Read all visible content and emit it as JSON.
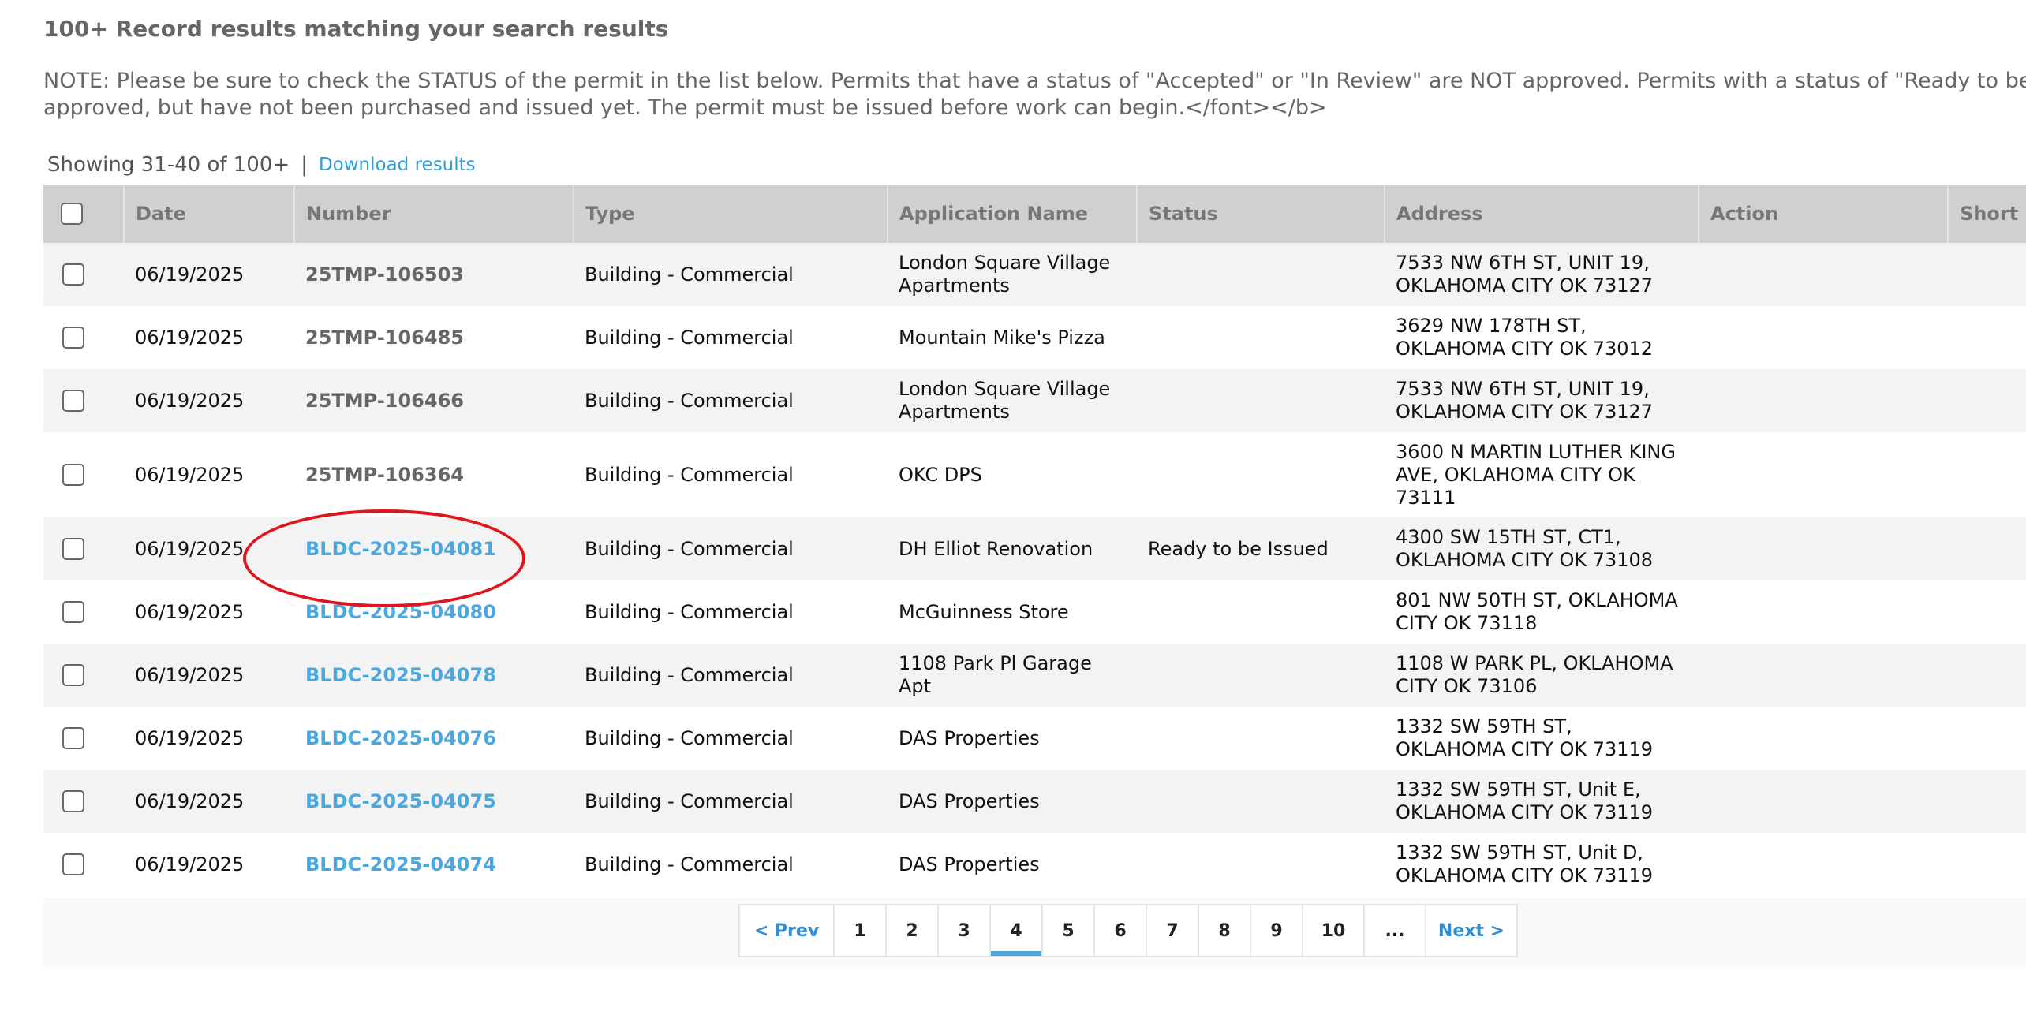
{
  "heading": "100+ Record results matching your search results",
  "note": "NOTE: Please be sure to check the STATUS of the permit in the list below. Permits that have a status of \"Accepted\" or \"In Review\" are NOT approved. Permits with a status of \"Ready to be Issued\" are approved, but have not been purchased and issued yet. The permit must be issued before work can begin.</font></b>",
  "showing": {
    "text": "Showing 31-40 of 100+",
    "separator": "|",
    "download_label": "Download results"
  },
  "table": {
    "headers": {
      "date": "Date",
      "number": "Number",
      "type": "Type",
      "application_name": "Application Name",
      "status": "Status",
      "address": "Address",
      "action": "Action",
      "short_notes": "Short Notes"
    },
    "rows": [
      {
        "date": "06/19/2025",
        "number": "25TMP-106503",
        "number_is_link": false,
        "type": "Building - Commercial",
        "application_name": "London Square Village Apartments",
        "status": "",
        "address": "7533 NW 6TH ST, UNIT 19, OKLAHOMA CITY OK 73127",
        "action": "",
        "short_notes": ""
      },
      {
        "date": "06/19/2025",
        "number": "25TMP-106485",
        "number_is_link": false,
        "type": "Building - Commercial",
        "application_name": "Mountain Mike's Pizza",
        "status": "",
        "address": "3629 NW 178TH ST, OKLAHOMA CITY OK 73012",
        "action": "",
        "short_notes": ""
      },
      {
        "date": "06/19/2025",
        "number": "25TMP-106466",
        "number_is_link": false,
        "type": "Building - Commercial",
        "application_name": "London Square Village Apartments",
        "status": "",
        "address": "7533 NW 6TH ST, UNIT 19, OKLAHOMA CITY OK 73127",
        "action": "",
        "short_notes": ""
      },
      {
        "date": "06/19/2025",
        "number": "25TMP-106364",
        "number_is_link": false,
        "type": "Building - Commercial",
        "application_name": "OKC DPS",
        "status": "",
        "address": "3600 N MARTIN LUTHER KING AVE, OKLAHOMA CITY OK 73111",
        "action": "",
        "short_notes": ""
      },
      {
        "date": "06/19/2025",
        "number": "BLDC-2025-04081",
        "number_is_link": true,
        "type": "Building - Commercial",
        "application_name": "DH Elliot Renovation",
        "status": "Ready to be Issued",
        "address": "4300 SW 15TH ST, CT1, OKLAHOMA CITY OK 73108",
        "action": "",
        "short_notes": ""
      },
      {
        "date": "06/19/2025",
        "number": "BLDC-2025-04080",
        "number_is_link": true,
        "type": "Building - Commercial",
        "application_name": "McGuinness Store",
        "status": "",
        "address": "801 NW 50TH ST, OKLAHOMA CITY OK 73118",
        "action": "",
        "short_notes": ""
      },
      {
        "date": "06/19/2025",
        "number": "BLDC-2025-04078",
        "number_is_link": true,
        "type": "Building - Commercial",
        "application_name": "1108 Park Pl Garage Apt",
        "status": "",
        "address": "1108 W PARK PL, OKLAHOMA CITY OK 73106",
        "action": "",
        "short_notes": ""
      },
      {
        "date": "06/19/2025",
        "number": "BLDC-2025-04076",
        "number_is_link": true,
        "type": "Building - Commercial",
        "application_name": "DAS Properties",
        "status": "",
        "address": "1332 SW 59TH ST, OKLAHOMA CITY OK 73119",
        "action": "",
        "short_notes": ""
      },
      {
        "date": "06/19/2025",
        "number": "BLDC-2025-04075",
        "number_is_link": true,
        "type": "Building - Commercial",
        "application_name": "DAS Properties",
        "status": "",
        "address": "1332 SW 59TH ST, Unit E, OKLAHOMA CITY OK 73119",
        "action": "",
        "short_notes": ""
      },
      {
        "date": "06/19/2025",
        "number": "BLDC-2025-04074",
        "number_is_link": true,
        "type": "Building - Commercial",
        "application_name": "DAS Properties",
        "status": "",
        "address": "1332 SW 59TH ST, Unit D, OKLAHOMA CITY OK 73119",
        "action": "",
        "short_notes": ""
      }
    ]
  },
  "pagination": {
    "prev_label": "< Prev",
    "pages": [
      "1",
      "2",
      "3",
      "4",
      "5",
      "6",
      "7",
      "8",
      "9",
      "10",
      "..."
    ],
    "current_page": "4",
    "next_label": "Next >"
  },
  "colors": {
    "link": "#4aa8df",
    "annotation": "#e0141c",
    "header_bg": "#d0d0d0"
  }
}
